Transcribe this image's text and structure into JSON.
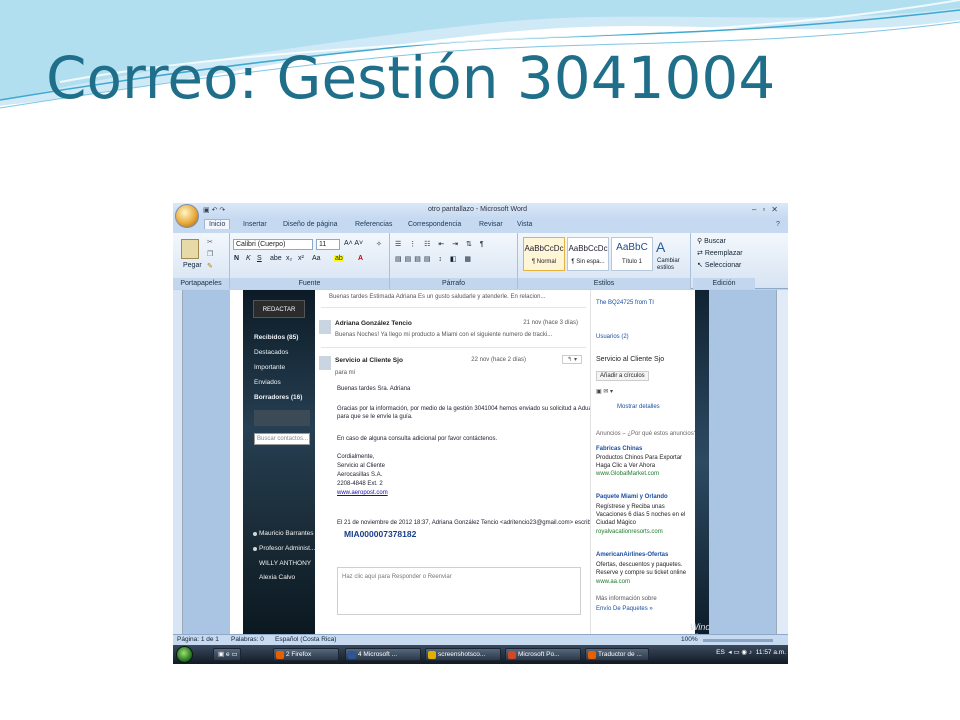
{
  "slide": {
    "title": "Correo: Gestión 3041004"
  },
  "word": {
    "window_title": "otro pantallazo - Microsoft Word",
    "tabs": [
      "Inicio",
      "Insertar",
      "Diseño de página",
      "Referencias",
      "Correspondencia",
      "Revisar",
      "Vista"
    ],
    "ribbon": {
      "paste_label": "Pegar",
      "font_name": "Calibri (Cuerpo)",
      "font_size": "11",
      "styles": [
        {
          "sample": "AaBbCcDc",
          "name": "¶ Normal"
        },
        {
          "sample": "AaBbCcDc",
          "name": "¶ Sin espa..."
        },
        {
          "sample": "AaBbC",
          "name": "Título 1"
        }
      ],
      "change_styles": "Cambiar estilos",
      "find": "Buscar",
      "replace": "Reemplazar",
      "select": "Seleccionar",
      "groups": {
        "clipboard": "Portapapeles",
        "font": "Fuente",
        "paragraph": "Párrafo",
        "styles": "Estilos",
        "editing": "Edición"
      }
    },
    "status": {
      "page": "Página: 1 de 1",
      "words": "Palabras: 0",
      "language": "Español (Costa Rica)",
      "zoom": "100%"
    }
  },
  "gmail": {
    "compose": "REDACTAR",
    "nav": [
      "Recibidos (85)",
      "Destacados",
      "Importante",
      "Enviados",
      "Borradores (16)"
    ],
    "search_contacts": "Buscar contactos...",
    "contacts": [
      "Mauricio Barrantes",
      "Profesor Administ...",
      "WILLY ANTHONY",
      "Alexia Calvo"
    ],
    "messages": [
      {
        "snippet": "Buenas tardes Estimada Adriana Es un gusto saludarle y atenderle. En relacion..."
      },
      {
        "sender": "Adriana González Tencio",
        "date": "21 nov (hace 3 días)",
        "snippet": "Buenas Noches! Ya llego mi producto a Miami con el siguiente numero de tracki..."
      },
      {
        "sender": "Servicio al Cliente Sjo",
        "date": "22 nov (hace 2 días)",
        "to": "para mí",
        "body": [
          "Buenas tardes Sra. Adriana",
          "Gracias por la información, por medio de la gestión 3041004 hemos enviado su solicitud a Aduanas",
          "para que se le envíe la guía.",
          "En caso de alguna consulta adicional por favor contáctenos.",
          "Cordialmente,",
          "Servicio al Cliente",
          "Aerocasillas S.A.",
          "2208-4848 Ext. 2",
          "www.aeropost.com",
          "El 21 de noviembre de 2012 18:37, Adriana González Tencio <adritencio23@gmail.com> escribió:"
        ],
        "tracking": "MIA000007378182"
      }
    ],
    "reply_prompt": "Haz clic aquí para Responder o Reenviar",
    "sidebar": {
      "top": "The BQ24725 from TI",
      "users": "Usuarios (2)",
      "contact_name": "Servicio al Cliente Sjo",
      "add_circles": "Añadir a círculos",
      "show_details": "Mostrar detalles",
      "ads_header": "Anuncios – ¿Por qué estos anuncios?",
      "ads": [
        {
          "title": "Fabricas Chinas",
          "lines": [
            "Productos Chinos Para Exportar",
            "Haga Clic a Ver Ahora"
          ],
          "url": "www.GlobalMarket.com"
        },
        {
          "title": "Paquete Miami y Orlando",
          "lines": [
            "Regístrese y Reciba unas",
            "Vacaciones 6 días 5 noches en el",
            "Ciudad Mágico"
          ],
          "url": "royalvacationresorts.com"
        },
        {
          "title": "AmericanAirlines-Ofertas",
          "lines": [
            "Ofertas, descuentos y paquetes.",
            "Reserve y compre su ticket online"
          ],
          "url": "www.aa.com"
        }
      ],
      "more_info": "Más información sobre",
      "more_link": "Envío De Paquetes »"
    },
    "watermark": "Windows Vista"
  },
  "taskbar": {
    "items": [
      "2 Firefox",
      "4 Microsoft ...",
      "screenshotsco...",
      "Microsoft Po...",
      "Traductor de ..."
    ],
    "lang": "ES",
    "clock": "11:57 a.m."
  },
  "colors": {
    "title": "#1f6f8b",
    "ribbon": "#d7e4f3",
    "link": "#1a0dab",
    "tracking": "#1b3d8a"
  }
}
